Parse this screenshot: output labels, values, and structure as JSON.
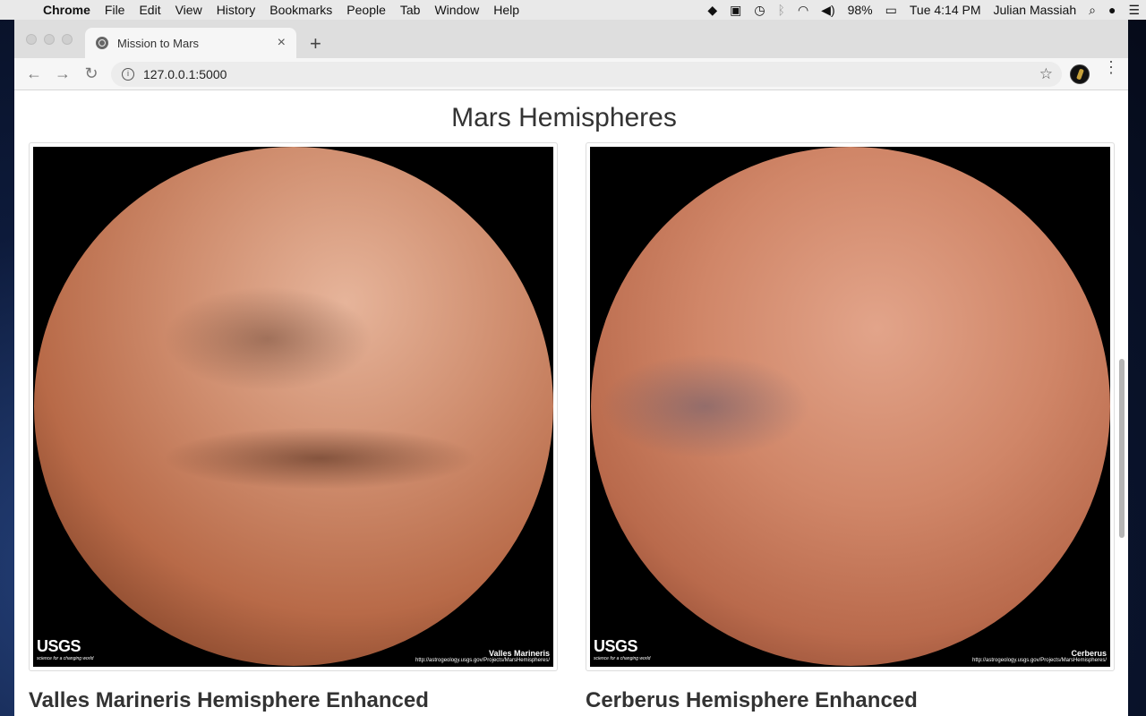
{
  "menubar": {
    "app": "Chrome",
    "items": [
      "File",
      "Edit",
      "View",
      "History",
      "Bookmarks",
      "People",
      "Tab",
      "Window",
      "Help"
    ],
    "battery": "98%",
    "clock": "Tue 4:14 PM",
    "user": "Julian Massiah"
  },
  "browser": {
    "tab_title": "Mission to Mars",
    "tab_close": "×",
    "new_tab": "+",
    "back": "←",
    "forward": "→",
    "reload": "↻",
    "url": "127.0.0.1:5000",
    "star": "☆",
    "menu": "⋮"
  },
  "page": {
    "heading": "Mars Hemispheres",
    "hemispheres": [
      {
        "title": "Valles Marineris Hemisphere Enhanced",
        "image_logo": "USGS",
        "image_tagline": "science for a changing world",
        "image_caption": "Valles Marineris",
        "image_link": "http://astrogeology.usgs.gov/Projects/MarsHemispheres/"
      },
      {
        "title": "Cerberus Hemisphere Enhanced",
        "image_logo": "USGS",
        "image_tagline": "science for a changing world",
        "image_caption": "Cerberus",
        "image_link": "http://astrogeology.usgs.gov/Projects/MarsHemispheres/"
      }
    ]
  }
}
